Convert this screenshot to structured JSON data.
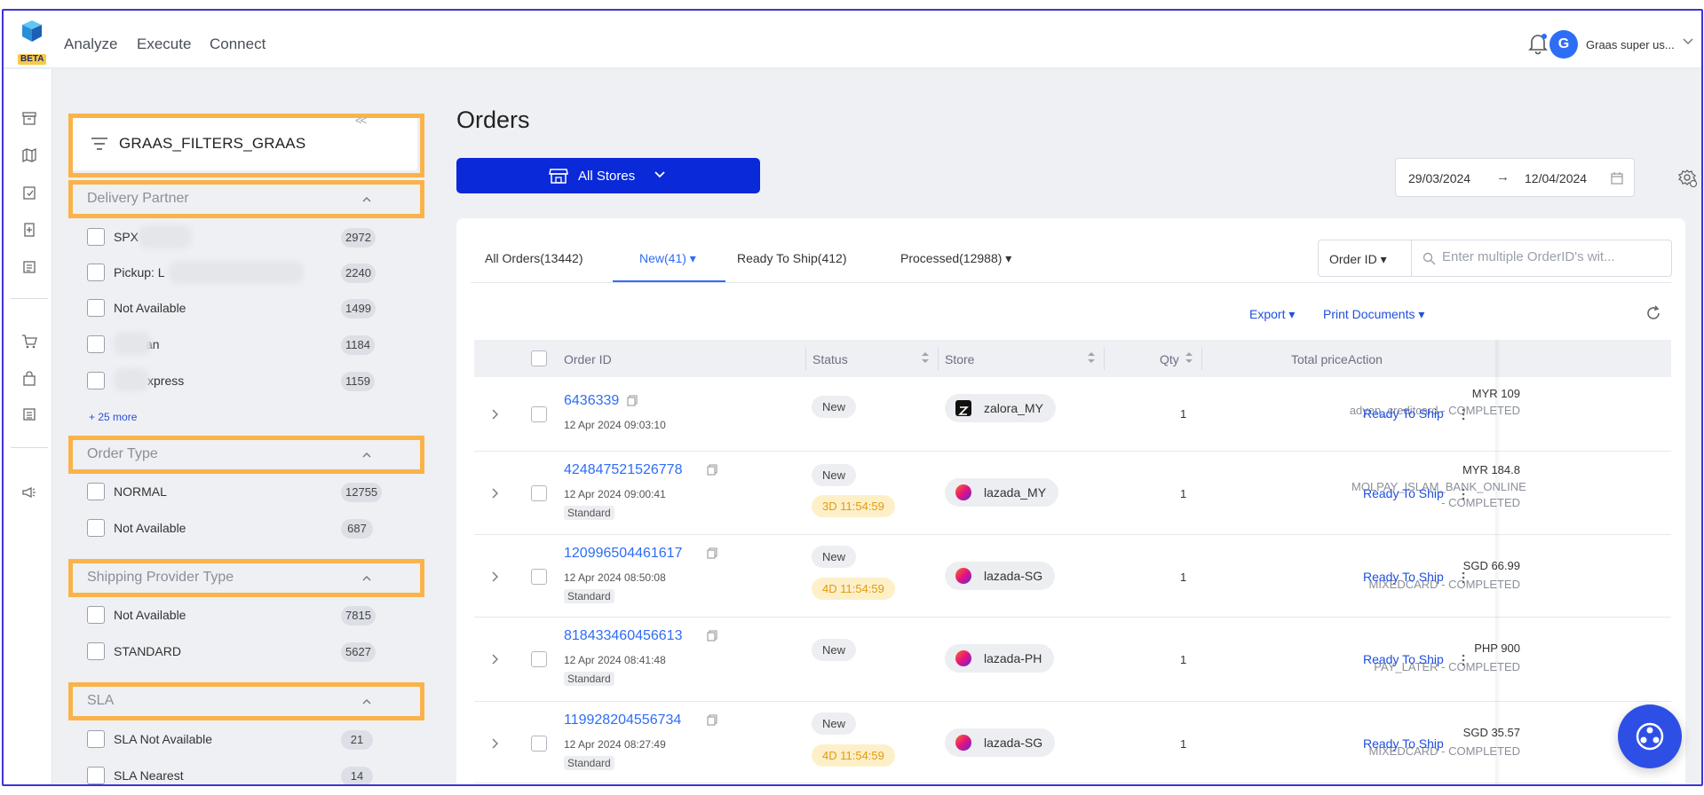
{
  "app": {
    "beta_label": "BETA"
  },
  "nav": {
    "items": [
      "Analyze",
      "Execute",
      "Connect"
    ]
  },
  "user": {
    "initial": "G",
    "name": "Graas super us..."
  },
  "filters": {
    "title": "GRAAS_FILTERS_GRAAS",
    "collapse_glyph": "<<",
    "sections": [
      {
        "title": "Delivery Partner",
        "options": [
          {
            "label": "SPX",
            "count": "2972"
          },
          {
            "label": "Pickup: L",
            "count": "2240"
          },
          {
            "label": "Not Available",
            "count": "1499"
          },
          {
            "label": "an",
            "count": "1184"
          },
          {
            "label": "xpress",
            "count": "1159"
          }
        ],
        "more": "+ 25 more"
      },
      {
        "title": "Order Type",
        "options": [
          {
            "label": "NORMAL",
            "count": "12755"
          },
          {
            "label": "Not Available",
            "count": "687"
          }
        ]
      },
      {
        "title": "Shipping Provider Type",
        "options": [
          {
            "label": "Not Available",
            "count": "7815"
          },
          {
            "label": "STANDARD",
            "count": "5627"
          }
        ]
      },
      {
        "title": "SLA",
        "options": [
          {
            "label": "SLA Not Available",
            "count": "21"
          },
          {
            "label": "SLA Nearest",
            "count": "14"
          }
        ]
      }
    ]
  },
  "main": {
    "title": "Orders",
    "stores_button": "All Stores",
    "date_from": "29/03/2024",
    "date_arrow": "→",
    "date_to": "12/04/2024",
    "tabs": [
      "All Orders(13442)",
      "New(41)",
      "Ready To Ship(412)",
      "Processed(12988)"
    ],
    "search_select": "Order ID",
    "search_placeholder": "Enter multiple OrderID's wit...",
    "export_label": "Export",
    "print_label": "Print Documents",
    "columns": [
      "Order ID",
      "Status",
      "Store",
      "Qty",
      "Total price",
      "Action"
    ],
    "rows": [
      {
        "id": "6436339",
        "date": "12 Apr 2024 09:03:10",
        "tag": "",
        "status": "New",
        "timer": "",
        "store": "zalora_MY",
        "store_type": "zalora",
        "qty": "1",
        "price": "MYR 109",
        "payment": "adyen_creditcard - COMPLETED",
        "action": "Ready To Ship"
      },
      {
        "id": "424847521526778",
        "date": "12 Apr 2024 09:00:41",
        "tag": "Standard",
        "status": "New",
        "timer": "3D 11:54:59",
        "store": "lazada_MY",
        "store_type": "lazada",
        "qty": "1",
        "price": "MYR 184.8",
        "payment": "MOLPAY_ISLAM_BANK_ONLINE - COMPLETED",
        "action": "Ready To Ship"
      },
      {
        "id": "120996504461617",
        "date": "12 Apr 2024 08:50:08",
        "tag": "Standard",
        "status": "New",
        "timer": "4D 11:54:59",
        "store": "lazada-SG",
        "store_type": "lazada",
        "qty": "1",
        "price": "SGD 66.99",
        "payment": "MIXEDCARD - COMPLETED",
        "action": "Ready To Ship"
      },
      {
        "id": "818433460456613",
        "date": "12 Apr 2024 08:41:48",
        "tag": "Standard",
        "status": "New",
        "timer": "",
        "store": "lazada-PH",
        "store_type": "lazada",
        "qty": "1",
        "price": "PHP 900",
        "payment": "PAY_LATER - COMPLETED",
        "action": "Ready To Ship"
      },
      {
        "id": "119928204556734",
        "date": "12 Apr 2024 08:27:49",
        "tag": "Standard",
        "status": "New",
        "timer": "4D 11:54:59",
        "store": "lazada-SG",
        "store_type": "lazada",
        "qty": "1",
        "price": "SGD 35.57",
        "payment": "MIXEDCARD - COMPLETED",
        "action": "Ready To Ship"
      }
    ]
  },
  "colors": {
    "accent": "#2e6df6",
    "primary_button": "#0a29d9",
    "highlight_border": "#f9b34a",
    "timer": "#e39a0e"
  }
}
